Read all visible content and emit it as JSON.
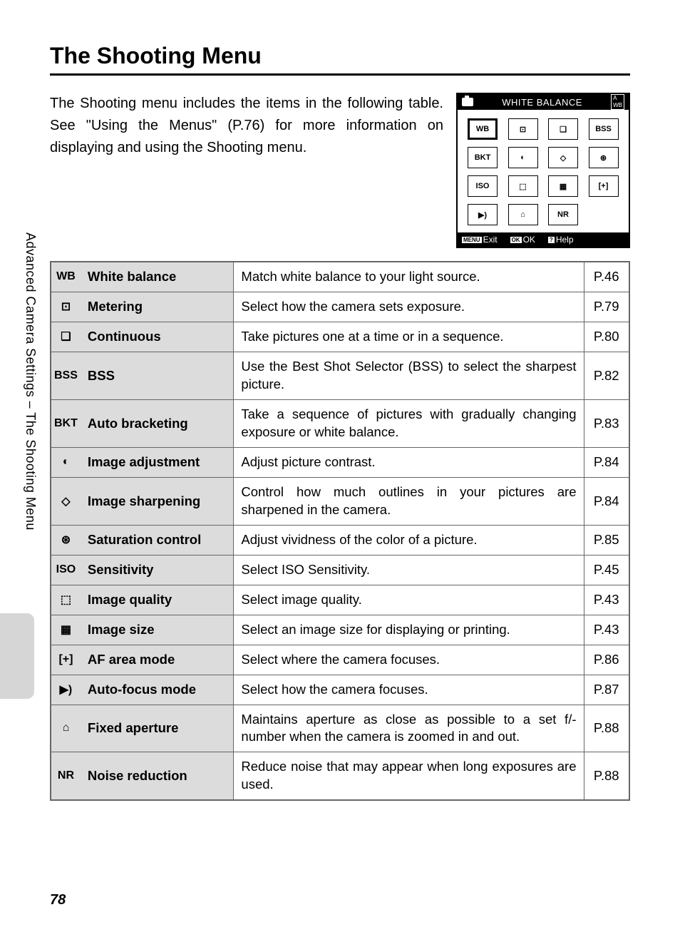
{
  "title": "The Shooting Menu",
  "intro": "The Shooting menu includes the items in the following table. See \"Using the Menus\" (P.76) for more information on displaying and using the Shooting menu.",
  "sidebar": "Advanced Camera Settings – The Shooting Menu",
  "page_number": "78",
  "screenshot": {
    "header_title": "WHITE BALANCE",
    "footer": {
      "exit": "Exit",
      "ok": "OK",
      "help": "Help",
      "menu_box": "MENU",
      "ok_box": "OK",
      "help_box": "?"
    },
    "grid": [
      {
        "label": "WB",
        "selected": true
      },
      {
        "label": "⊡"
      },
      {
        "label": "❏"
      },
      {
        "label": "BSS"
      },
      {
        "label": "BKT"
      },
      {
        "label": "◐"
      },
      {
        "label": "◇"
      },
      {
        "label": "⊛"
      },
      {
        "label": "ISO"
      },
      {
        "label": "⬚"
      },
      {
        "label": "▦"
      },
      {
        "label": "[+]"
      },
      {
        "label": "▶)"
      },
      {
        "label": "⌂"
      },
      {
        "label": "NR"
      },
      {
        "label": ""
      }
    ]
  },
  "rows": [
    {
      "icon": "WB",
      "name": "White balance",
      "desc": "Match white balance to your light source.",
      "page": "P.46"
    },
    {
      "icon": "⊡",
      "name": "Metering",
      "desc": "Select how the camera sets exposure.",
      "page": "P.79"
    },
    {
      "icon": "❏",
      "name": "Continuous",
      "desc": "Take pictures one at a time or in a sequence.",
      "page": "P.80"
    },
    {
      "icon": "BSS",
      "name": "BSS",
      "desc": "Use the Best Shot Selector (BSS) to select the sharpest picture.",
      "page": "P.82"
    },
    {
      "icon": "BKT",
      "name": "Auto bracketing",
      "desc": "Take a sequence of pictures with gradually changing exposure or white balance.",
      "page": "P.83"
    },
    {
      "icon": "◐",
      "name": "Image adjustment",
      "desc": "Adjust picture contrast.",
      "page": "P.84"
    },
    {
      "icon": "◇",
      "name": "Image sharpening",
      "desc": "Control how much outlines in your pictures are sharpened in the camera.",
      "page": "P.84"
    },
    {
      "icon": "⊛",
      "name": "Saturation control",
      "desc": "Adjust vividness of the color of a picture.",
      "page": "P.85"
    },
    {
      "icon": "ISO",
      "name": "Sensitivity",
      "desc": "Select ISO Sensitivity.",
      "page": "P.45"
    },
    {
      "icon": "⬚",
      "name": "Image quality",
      "desc": "Select image quality.",
      "page": "P.43"
    },
    {
      "icon": "▦",
      "name": "Image size",
      "desc": "Select an image size for displaying or printing.",
      "page": "P.43"
    },
    {
      "icon": "[+]",
      "name": "AF area mode",
      "desc": "Select where the camera focuses.",
      "page": "P.86"
    },
    {
      "icon": "▶)",
      "name": "Auto-focus mode",
      "desc": "Select how the camera focuses.",
      "page": "P.87"
    },
    {
      "icon": "⌂",
      "name": "Fixed aperture",
      "desc": "Maintains aperture as close as possible to a set f/-number when the camera is zoomed in and out.",
      "page": "P.88"
    },
    {
      "icon": "NR",
      "name": "Noise reduction",
      "desc": "Reduce noise that may appear when long exposures are used.",
      "page": "P.88"
    }
  ]
}
